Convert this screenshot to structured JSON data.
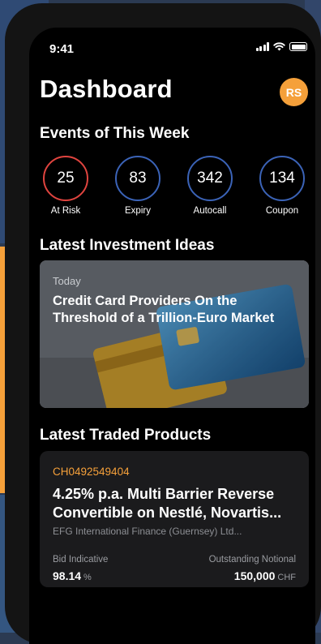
{
  "status": {
    "time": "9:41"
  },
  "header": {
    "title": "Dashboard",
    "avatar_initials": "RS"
  },
  "colors": {
    "accent": "#f5a03a",
    "risk_ring": "#e0443f",
    "ring": "#3b63b7"
  },
  "events": {
    "title": "Events of This Week",
    "items": [
      {
        "value": "25",
        "label": "At Risk"
      },
      {
        "value": "83",
        "label": "Expiry"
      },
      {
        "value": "342",
        "label": "Autocall"
      },
      {
        "value": "134",
        "label": "Coupon"
      }
    ]
  },
  "ideas": {
    "title": "Latest Investment Ideas",
    "card": {
      "date": "Today",
      "title": "Credit Card Providers On the Threshold of a Trillion-Euro Market"
    }
  },
  "products": {
    "title": "Latest Traded Products",
    "card": {
      "isin": "CH0492549404",
      "title": "4.25% p.a. Multi Barrier Reverse Convertible on Nestlé, Novartis...",
      "issuer": "EFG International Finance (Guernsey) Ltd...",
      "bid_label": "Bid Indicative",
      "bid_value": "98.14",
      "bid_unit": "%",
      "notional_label": "Outstanding Notional",
      "notional_value": "150,000",
      "notional_unit": "CHF"
    }
  }
}
